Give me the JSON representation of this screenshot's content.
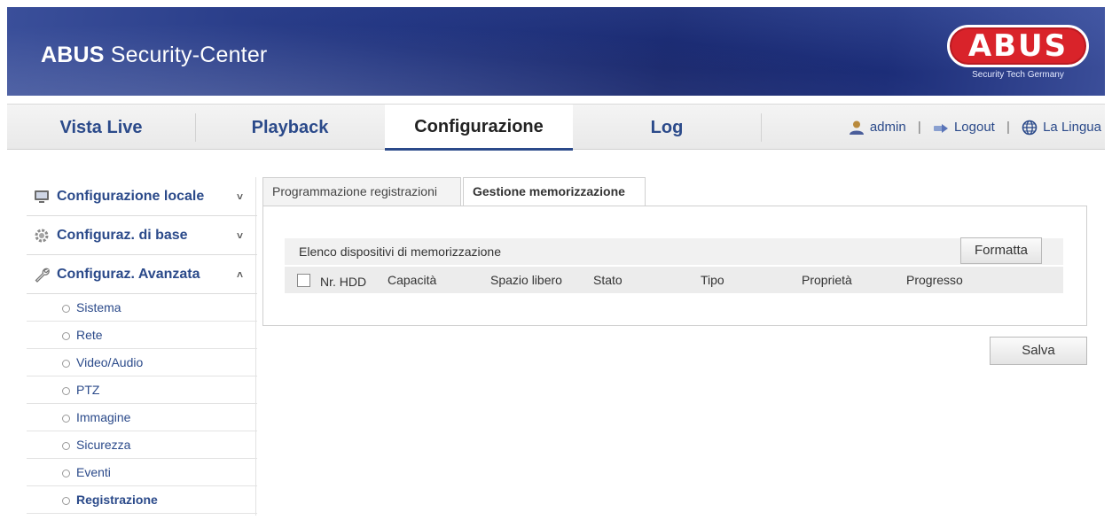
{
  "header": {
    "title_bold": "ABUS",
    "title_rest": " Security-Center",
    "logo_text": "ABUS",
    "logo_tagline": "Security Tech Germany"
  },
  "nav": {
    "tabs": [
      {
        "label": "Vista Live"
      },
      {
        "label": "Playback"
      },
      {
        "label": "Configurazione"
      },
      {
        "label": "Log"
      }
    ],
    "user": "admin",
    "logout": "Logout",
    "language": "La Lingua"
  },
  "sidebar": {
    "sections": [
      {
        "label": "Configurazione locale",
        "chevron": "˅"
      },
      {
        "label": "Configuraz. di base",
        "chevron": "˅"
      },
      {
        "label": "Configuraz. Avanzata",
        "chevron": "˄"
      }
    ],
    "items": [
      {
        "label": "Sistema"
      },
      {
        "label": "Rete"
      },
      {
        "label": "Video/Audio"
      },
      {
        "label": "PTZ"
      },
      {
        "label": "Immagine"
      },
      {
        "label": "Sicurezza"
      },
      {
        "label": "Eventi"
      },
      {
        "label": "Registrazione"
      }
    ]
  },
  "content": {
    "tabs": [
      {
        "label": "Programmazione registrazioni"
      },
      {
        "label": "Gestione memorizzazione"
      }
    ],
    "list_title": "Elenco dispositivi di memorizzazione",
    "format_button": "Formatta",
    "columns": [
      "Nr. HDD",
      "Capacità",
      "Spazio libero",
      "Stato",
      "Tipo",
      "Proprietà",
      "Progresso"
    ],
    "save_button": "Salva"
  },
  "colors": {
    "accent": "#2b4a8a",
    "logo_red": "#d9232a",
    "banner": "#1c2d78"
  }
}
